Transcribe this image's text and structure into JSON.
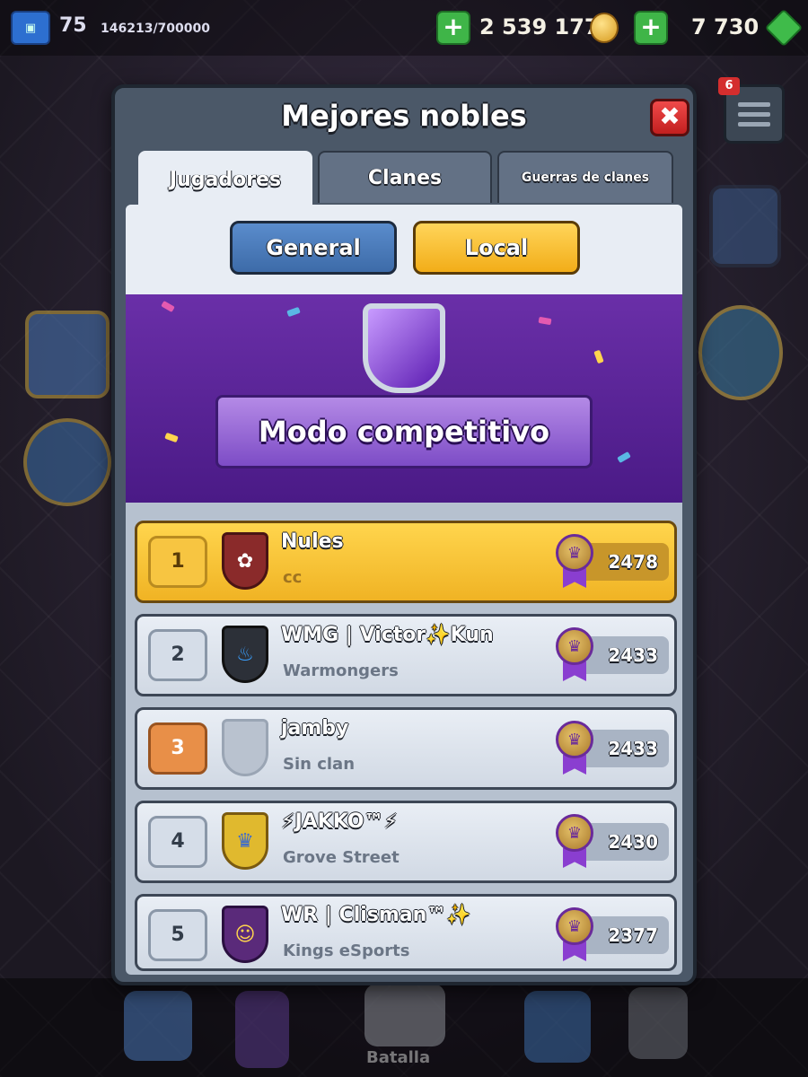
{
  "topbar": {
    "level": "75",
    "xp": "146213/700000",
    "gold": "2 539 177",
    "gems": "7 730",
    "add_icon": "+",
    "notif_count": "6"
  },
  "bottombar": {
    "battle_label": "Batalla"
  },
  "modal": {
    "title": "Mejores nobles",
    "close_icon": "✖",
    "tabs": [
      {
        "label": "Jugadores",
        "active": true
      },
      {
        "label": "Clanes",
        "active": false
      },
      {
        "label": "Guerras de clanes",
        "active": false
      }
    ],
    "filters": {
      "general": "General",
      "local": "Local",
      "selected": "Local"
    },
    "banner": {
      "title": "Modo competitivo"
    },
    "players": [
      {
        "rank": "1",
        "name": "Nules",
        "clan": "cc",
        "trophies": "2478",
        "badge_icon": "sakura-shield-icon",
        "badge_color": "#8a2a2a"
      },
      {
        "rank": "2",
        "name": "WMG | Victor✨Kun",
        "clan": "Warmongers",
        "trophies": "2433",
        "badge_icon": "blue-flame-shield-icon",
        "badge_color": "#2c3038"
      },
      {
        "rank": "3",
        "name": "jamby",
        "clan": "Sin clan",
        "trophies": "2433",
        "badge_icon": "empty-shield-icon",
        "badge_color": "#b9c2cf"
      },
      {
        "rank": "4",
        "name": "⚡JAKKO™⚡",
        "clan": "Grove Street",
        "trophies": "2430",
        "badge_icon": "gold-crown-banner-icon",
        "badge_color": "#e0b92e"
      },
      {
        "rank": "5",
        "name": "WR | Clisman™✨",
        "clan": "Kings eSports",
        "trophies": "2377",
        "badge_icon": "king-emote-badge-icon",
        "badge_color": "#5a2a7a"
      }
    ]
  },
  "colors": {
    "gold_row": "#f0b324",
    "silver_row": "#d1d9e4",
    "banner_purple": "#5a1f98",
    "medal_ribbon": "#8a3ed0"
  }
}
